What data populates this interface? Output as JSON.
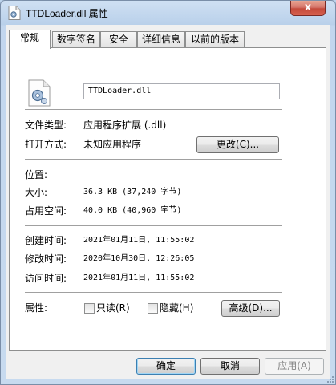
{
  "window": {
    "title": "TTDLoader.dll 属性",
    "close_symbol": "x"
  },
  "tabs": [
    {
      "label": "常规",
      "active": true
    },
    {
      "label": "数字签名",
      "active": false
    },
    {
      "label": "安全",
      "active": false
    },
    {
      "label": "详细信息",
      "active": false
    },
    {
      "label": "以前的版本",
      "active": false
    }
  ],
  "general": {
    "file_name": "TTDLoader.dll",
    "file_type_label": "文件类型:",
    "file_type_value": "应用程序扩展 (.dll)",
    "open_with_label": "打开方式:",
    "open_with_value": "未知应用程序",
    "change_button": "更改(C)...",
    "location_label": "位置:",
    "location_value": "",
    "size_label": "大小:",
    "size_value": "36.3 KB (37,240 字节)",
    "size_on_disk_label": "占用空间:",
    "size_on_disk_value": "40.0 KB (40,960 字节)",
    "created_label": "创建时间:",
    "created_value": "2021年01月11日, 11:55:02",
    "modified_label": "修改时间:",
    "modified_value": "2020年10月30日, 12:26:05",
    "accessed_label": "访问时间:",
    "accessed_value": "2021年01月11日, 11:55:02",
    "attributes_label": "属性:",
    "readonly_label": "只读(R)",
    "readonly_checked": false,
    "hidden_label": "隐藏(H)",
    "hidden_checked": false,
    "advanced_button": "高级(D)..."
  },
  "footer": {
    "ok_button": "确定",
    "cancel_button": "取消",
    "apply_button": "应用(A)"
  }
}
